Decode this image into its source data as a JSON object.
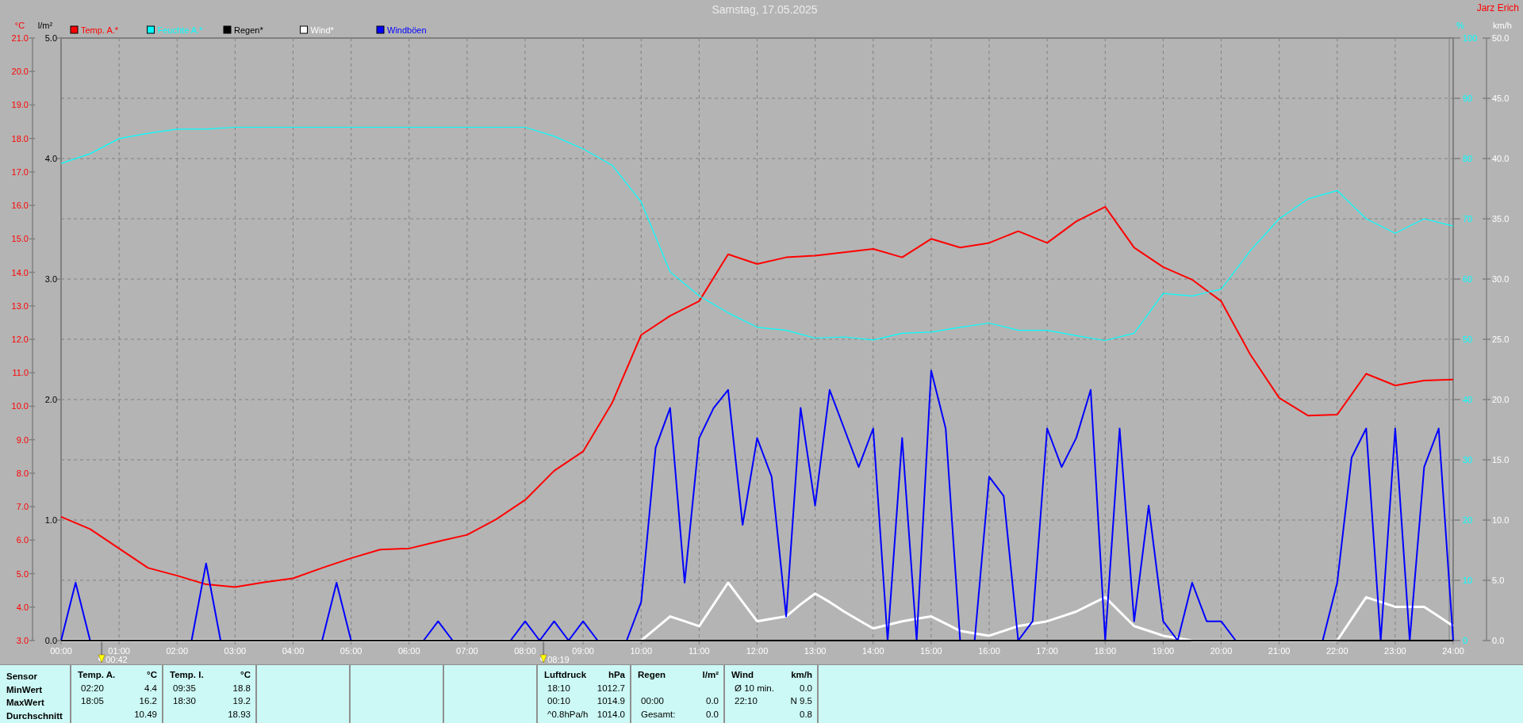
{
  "title": "Samstag, 17.05.2025",
  "author": "Jarz Erich",
  "chart": {
    "markers": [
      {
        "time": "00:42"
      },
      {
        "time": "08:19"
      }
    ],
    "plots": [
      {
        "chart_data": {
          "type": "line",
          "grid": true,
          "ylabel": "°C",
          "xlim": [
            0,
            24
          ],
          "ylim": [
            3,
            21
          ],
          "x": [
            0,
            0.5,
            1,
            1.5,
            2,
            2.5,
            3,
            3.5,
            4,
            4.5,
            5,
            5.5,
            6,
            6.5,
            7,
            7.5,
            8,
            8.5,
            9,
            9.5,
            10,
            10.5,
            11,
            11.5,
            12,
            12.5,
            13,
            13.5,
            14,
            14.5,
            15,
            15.5,
            16,
            16.5,
            17,
            17.5,
            18,
            18.5,
            19,
            19.5,
            20,
            20.5,
            21,
            21.5,
            22,
            22.5,
            23,
            23.5,
            24
          ],
          "xticks": [
            {
              "value": 0,
              "label": "00:00"
            },
            {
              "value": 1,
              "label": "01:00"
            },
            {
              "value": 2,
              "label": "02:00"
            },
            {
              "value": 3,
              "label": "03:00"
            },
            {
              "value": 4,
              "label": "04:00"
            },
            {
              "value": 5,
              "label": "05:00"
            },
            {
              "value": 6,
              "label": "06:00"
            },
            {
              "value": 7,
              "label": "07:00"
            },
            {
              "value": 8,
              "label": "08:00"
            },
            {
              "value": 9,
              "label": "09:00"
            },
            {
              "value": 10,
              "label": "10:00"
            },
            {
              "value": 11,
              "label": "11:00"
            },
            {
              "value": 12,
              "label": "12:00"
            },
            {
              "value": 13,
              "label": "13:00"
            },
            {
              "value": 14,
              "label": "14:00"
            },
            {
              "value": 15,
              "label": "15:00"
            },
            {
              "value": 16,
              "label": "16:00"
            },
            {
              "value": 17,
              "label": "17:00"
            },
            {
              "value": 18,
              "label": "18:00"
            },
            {
              "value": 19,
              "label": "19:00"
            },
            {
              "value": 20,
              "label": "20:00"
            },
            {
              "value": 21,
              "label": "21:00"
            },
            {
              "value": 22,
              "label": "22:00"
            },
            {
              "value": 23,
              "label": "23:00"
            },
            {
              "value": 24,
              "label": "24:00"
            }
          ],
          "yticks": [
            {
              "value": 3,
              "label": "3.0"
            },
            {
              "value": 4,
              "label": "4.0"
            },
            {
              "value": 5,
              "label": "5.0"
            },
            {
              "value": 6,
              "label": "6.0"
            },
            {
              "value": 7,
              "label": "7.0"
            },
            {
              "value": 8,
              "label": "8.0"
            },
            {
              "value": 9,
              "label": "9.0"
            },
            {
              "value": 10,
              "label": "10.0"
            },
            {
              "value": 11,
              "label": "11.0"
            },
            {
              "value": 12,
              "label": "12.0"
            },
            {
              "value": 13,
              "label": "13.0"
            },
            {
              "value": 14,
              "label": "14.0"
            },
            {
              "value": 15,
              "label": "15.0"
            },
            {
              "value": 16,
              "label": "16.0"
            },
            {
              "value": 17,
              "label": "17.0"
            },
            {
              "value": 18,
              "label": "18.0"
            },
            {
              "value": 19,
              "label": "19.0"
            },
            {
              "value": 20,
              "label": "20.0"
            },
            {
              "value": 21,
              "label": "21.0"
            }
          ],
          "series": [
            {
              "name": "Temp. A.*",
              "color": "#ff0000",
              "values": [
                6.7,
                6.33,
                5.75,
                5.17,
                4.94,
                4.68,
                4.6,
                4.74,
                4.86,
                5.17,
                5.46,
                5.72,
                5.75,
                5.96,
                6.16,
                6.62,
                7.2,
                8.07,
                8.65,
                10.1,
                12.13,
                12.7,
                13.14,
                14.54,
                14.25,
                14.45,
                14.5,
                14.6,
                14.7,
                14.45,
                15.0,
                14.74,
                14.88,
                15.23,
                14.88,
                15.52,
                15.96,
                14.74,
                14.16,
                13.78,
                13.14,
                11.55,
                10.25,
                9.72,
                9.75,
                10.97,
                10.62,
                10.77,
                10.8
              ]
            }
          ]
        }
      },
      {
        "chart_data": {
          "type": "line",
          "ylabel": "%",
          "xlim": [
            0,
            24
          ],
          "ylim": [
            0,
            100
          ],
          "x": [
            0,
            0.5,
            1,
            1.5,
            2,
            2.5,
            3,
            3.5,
            4,
            4.5,
            5,
            5.5,
            6,
            6.5,
            7,
            7.5,
            8,
            8.5,
            9,
            9.5,
            10,
            10.5,
            11,
            11.5,
            12,
            12.5,
            13,
            13.5,
            14,
            14.5,
            15,
            15.5,
            16,
            16.5,
            17,
            17.5,
            18,
            18.5,
            19,
            19.5,
            20,
            20.5,
            21,
            21.5,
            22,
            22.5,
            23,
            23.5,
            24
          ],
          "yticks": [
            0,
            10,
            20,
            30,
            40,
            50,
            60,
            70,
            80,
            90,
            100
          ],
          "series": [
            {
              "name": "Feuchte A.*",
              "color": "#00ffff",
              "values": [
                79.2,
                80.8,
                83.3,
                84.2,
                84.9,
                84.9,
                85.2,
                85.2,
                85.2,
                85.2,
                85.2,
                85.2,
                85.2,
                85.2,
                85.2,
                85.2,
                85.2,
                83.7,
                81.6,
                78.9,
                72.8,
                61.2,
                57.2,
                54.4,
                52,
                51.5,
                50.2,
                50.4,
                49.9,
                51,
                51.2,
                52,
                52.7,
                51.5,
                51.5,
                50.6,
                49.8,
                51,
                57.6,
                57.2,
                58.3,
                64.7,
                70,
                73.3,
                74.7,
                70,
                67.6,
                70,
                68.8
              ]
            }
          ]
        }
      },
      {
        "chart_data": {
          "type": "line",
          "ylabel": "l/m²",
          "xlim": [
            0,
            24
          ],
          "ylim": [
            0,
            5
          ],
          "x": [
            0,
            1,
            2,
            3,
            4,
            5,
            6,
            7,
            8,
            9,
            10,
            11,
            12,
            13,
            14,
            15,
            16,
            17,
            18,
            19,
            20,
            21,
            22,
            23,
            24
          ],
          "yticks": [
            {
              "value": 0,
              "label": "0.0"
            },
            {
              "value": 1,
              "label": "1.0"
            },
            {
              "value": 2,
              "label": "2.0"
            },
            {
              "value": 3,
              "label": "3.0"
            },
            {
              "value": 4,
              "label": "4.0"
            },
            {
              "value": 5,
              "label": "5.0"
            }
          ],
          "series": [
            {
              "name": "Regen*",
              "color": "#000000",
              "values": [
                0,
                0,
                0,
                0,
                0,
                0,
                0,
                0,
                0,
                0,
                0,
                0,
                0,
                0,
                0,
                0,
                0,
                0,
                0,
                0,
                0,
                0,
                0,
                0,
                0
              ]
            }
          ]
        }
      },
      {
        "chart_data": {
          "type": "line",
          "ylabel": "km/h",
          "xlim": [
            0,
            24
          ],
          "ylim": [
            0,
            50
          ],
          "x": [
            0,
            0.25,
            0.5,
            0.75,
            1,
            1.25,
            1.5,
            1.75,
            2,
            2.25,
            2.5,
            2.75,
            3,
            3.25,
            3.5,
            3.75,
            4,
            4.25,
            4.5,
            4.75,
            5,
            5.25,
            5.5,
            5.75,
            6,
            6.25,
            6.5,
            6.75,
            7,
            7.25,
            7.5,
            7.75,
            8,
            8.25,
            8.5,
            8.75,
            9,
            9.25,
            9.5,
            9.75,
            10,
            10.25,
            10.5,
            10.75,
            11,
            11.25,
            11.5,
            11.75,
            12,
            12.25,
            12.5,
            12.75,
            13,
            13.25,
            13.5,
            13.75,
            14,
            14.25,
            14.5,
            14.75,
            15,
            15.25,
            15.5,
            15.75,
            16,
            16.25,
            16.5,
            16.75,
            17,
            17.25,
            17.5,
            17.75,
            18,
            18.25,
            18.5,
            18.75,
            19,
            19.25,
            19.5,
            19.75,
            20,
            20.25,
            20.5,
            20.75,
            21,
            21.25,
            21.5,
            21.75,
            22,
            22.25,
            22.5,
            22.75,
            23,
            23.25,
            23.5,
            23.75,
            24
          ],
          "yticks": [
            {
              "value": 0,
              "label": "0.0"
            },
            {
              "value": 5,
              "label": "5.0"
            },
            {
              "value": 10,
              "label": "10.0"
            },
            {
              "value": 15,
              "label": "15.0"
            },
            {
              "value": 20,
              "label": "20.0"
            },
            {
              "value": 25,
              "label": "25.0"
            },
            {
              "value": 30,
              "label": "30.0"
            },
            {
              "value": 35,
              "label": "35.0"
            },
            {
              "value": 40,
              "label": "40.0"
            },
            {
              "value": 45,
              "label": "45.0"
            },
            {
              "value": 50,
              "label": "50.0"
            }
          ],
          "series": [
            {
              "name": "Wind*",
              "color": "#ffffff",
              "values": [
                0,
                0,
                0,
                0,
                0,
                0,
                0,
                0,
                0,
                0,
                0,
                0,
                0,
                0,
                0,
                0,
                0,
                0,
                0,
                0,
                0,
                0,
                0,
                0,
                0,
                0,
                0,
                0,
                0,
                0,
                0,
                0,
                0,
                0,
                0,
                0,
                0,
                0,
                0,
                0,
                0,
                1.0,
                2.0,
                1.6,
                1.2,
                3.0,
                4.8,
                3.2,
                1.6,
                1.8,
                2,
                3.0,
                3.9,
                3.2,
                2.4,
                1.7,
                1,
                1.3,
                1.6,
                1.8,
                2,
                1.4,
                0.8,
                0.6,
                0.4,
                0.8,
                1.2,
                1.4,
                1.6,
                2.0,
                2.4,
                3.0,
                3.6,
                2.4,
                1.2,
                0.8,
                0.4,
                0.2,
                0,
                0,
                0,
                0,
                0,
                0,
                0,
                0,
                0,
                0,
                0,
                1.8,
                3.6,
                3.2,
                2.8,
                2.8,
                2.8,
                2.0,
                1.2
              ]
            },
            {
              "name": "Windböen",
              "color": "#0000ff",
              "values": [
                0,
                4.8,
                0,
                0,
                0,
                0,
                0,
                0,
                0,
                0,
                6.4,
                0,
                0,
                0,
                0,
                0,
                0,
                0,
                0,
                4.8,
                0,
                0,
                0,
                0,
                0,
                0,
                1.6,
                0,
                0,
                0,
                0,
                0,
                1.6,
                0,
                1.6,
                0,
                1.6,
                0,
                0,
                0,
                3.2,
                16,
                19.3,
                4.8,
                16.8,
                19.3,
                20.8,
                9.6,
                16.8,
                13.6,
                2,
                19.3,
                11.2,
                20.8,
                17.6,
                14.4,
                17.6,
                0,
                16.8,
                0,
                22.4,
                17.6,
                0,
                0,
                13.6,
                12,
                0,
                1.6,
                17.6,
                14.4,
                16.8,
                20.8,
                0,
                17.6,
                1.6,
                11.2,
                1.6,
                0,
                4.8,
                1.6,
                1.6,
                0,
                0,
                0,
                0,
                0,
                0,
                0,
                4.8,
                15.2,
                17.6,
                0,
                17.6,
                0,
                14.4,
                17.6,
                0
              ]
            }
          ]
        }
      }
    ]
  },
  "stats_table": {
    "row_labels": [
      "Sensor",
      "MinWert",
      "MaxWert",
      "Durchschnitt"
    ],
    "blocks": [
      {
        "kind": "values",
        "title": "Temp. A.",
        "unit": "°C",
        "rows": [
          {
            "time": "02:20",
            "value": "4.4"
          },
          {
            "time": "18:05",
            "value": "16.2"
          },
          {
            "value": "10.49"
          }
        ]
      },
      {
        "kind": "values",
        "title": "Temp. I.",
        "unit": "°C",
        "rows": [
          {
            "time": "09:35",
            "value": "18.8"
          },
          {
            "time": "18:30",
            "value": "19.2"
          },
          {
            "value": "18.93"
          }
        ]
      },
      {
        "kind": "empty"
      },
      {
        "kind": "empty"
      },
      {
        "kind": "empty"
      },
      {
        "kind": "values",
        "title": "Luftdruck",
        "unit": "hPa",
        "rows": [
          {
            "time": "18:10",
            "value": "1012.7"
          },
          {
            "time": "00:10",
            "value": "1014.9"
          },
          {
            "time": "^0.8hPa/h",
            "value": "1014.0"
          }
        ]
      },
      {
        "kind": "values",
        "title": "Regen",
        "unit": "l/m²",
        "rows": [
          {},
          {
            "time": "00:00",
            "value": "0.0"
          },
          {
            "time": "Gesamt:",
            "value": "0.0"
          }
        ]
      },
      {
        "kind": "values",
        "title": "Wind",
        "unit": "km/h",
        "rows": [
          {
            "time": "Ø 10 min.",
            "value": "0.0"
          },
          {
            "time": "22:10",
            "value": "N 9.5"
          },
          {
            "value": "0.8"
          }
        ]
      }
    ]
  }
}
